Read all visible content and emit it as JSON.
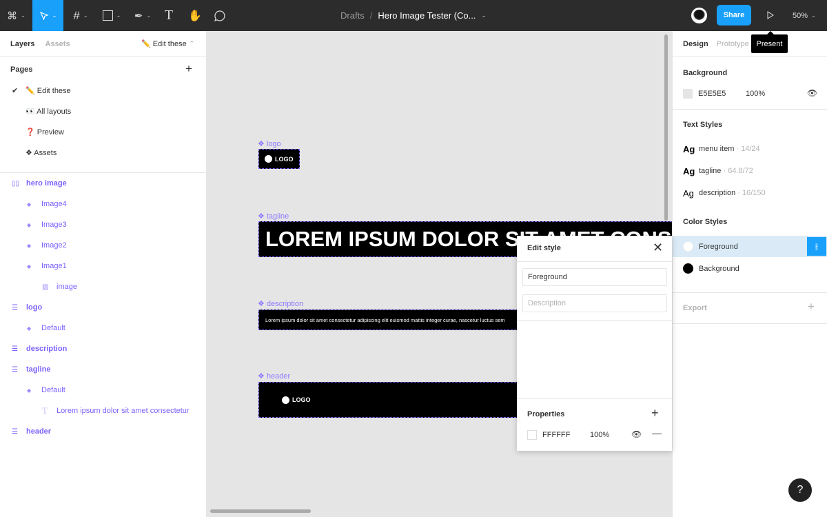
{
  "topbar": {
    "breadcrumb": "Drafts",
    "separator": "/",
    "file_title": "Hero Image Tester (Co...",
    "share_label": "Share",
    "zoom_level": "50%",
    "tooltip": "Present",
    "accent": "#18a0fb"
  },
  "left_panel": {
    "tabs": [
      "Layers",
      "Assets"
    ],
    "current_page": "✏️ Edit these",
    "pages_heading": "Pages",
    "pages": [
      {
        "label": "✏️ Edit these",
        "checked": true
      },
      {
        "label": "👀 All layouts",
        "checked": false
      },
      {
        "label": "❓ Preview",
        "checked": false
      },
      {
        "label": "❖ Assets",
        "checked": false
      }
    ],
    "layers": [
      {
        "label": "hero image",
        "level": 0,
        "icon": "columns-icon"
      },
      {
        "label": "Image4",
        "level": 1,
        "icon": "component-icon"
      },
      {
        "label": "Image3",
        "level": 1,
        "icon": "component-icon"
      },
      {
        "label": "Image2",
        "level": 1,
        "icon": "component-icon"
      },
      {
        "label": "Image1",
        "level": 1,
        "icon": "component-icon"
      },
      {
        "label": "image",
        "level": 2,
        "icon": "image-icon"
      },
      {
        "label": "logo",
        "level": 0,
        "icon": "rows-icon"
      },
      {
        "label": "Default",
        "level": 1,
        "icon": "component-icon"
      },
      {
        "label": "description",
        "level": 0,
        "icon": "rows-icon"
      },
      {
        "label": "tagline",
        "level": 0,
        "icon": "rows-icon"
      },
      {
        "label": "Default",
        "level": 1,
        "icon": "component-icon"
      },
      {
        "label": "Lorem ipsum dolor sit amet consectetur",
        "level": 2,
        "icon": "text-icon"
      },
      {
        "label": "header",
        "level": 0,
        "icon": "rows-icon"
      }
    ]
  },
  "canvas": {
    "background": "#E5E5E5",
    "logo_label": "logo",
    "logo_text": "LOGO",
    "tagline_label": "tagline",
    "tagline_text": "LOREM IPSUM DOLOR SIT AMET CONSECTETUR",
    "description_label": "description",
    "description_text": "Lorem ipsum dolor sit amet consectetur adipiscing elit euismod mattis integer curae, nascetur luctus sem",
    "header_label": "header",
    "header_logo_text": "LOGO"
  },
  "edit_style": {
    "title": "Edit style",
    "name_value": "Foreground",
    "description_placeholder": "Description",
    "properties_heading": "Properties",
    "fill_hex": "FFFFFF",
    "fill_opacity": "100%"
  },
  "right_panel": {
    "tabs": [
      "Design",
      "Prototype"
    ],
    "background_heading": "Background",
    "background_hex": "E5E5E5",
    "background_opacity": "100%",
    "text_styles_heading": "Text Styles",
    "text_styles": [
      {
        "sample": "Ag",
        "name": "menu item",
        "meta": " · 14/24"
      },
      {
        "sample": "Ag",
        "name": "tagline",
        "meta": " · 64.8/72"
      },
      {
        "sample": "Ag",
        "name": "description",
        "meta": " · 16/150"
      }
    ],
    "color_styles_heading": "Color Styles",
    "color_styles": [
      {
        "name": "Foreground",
        "color": "#FFFFFF",
        "selected": true
      },
      {
        "name": "Background",
        "color": "#000000",
        "selected": false
      }
    ],
    "export_heading": "Export"
  },
  "help_label": "?"
}
